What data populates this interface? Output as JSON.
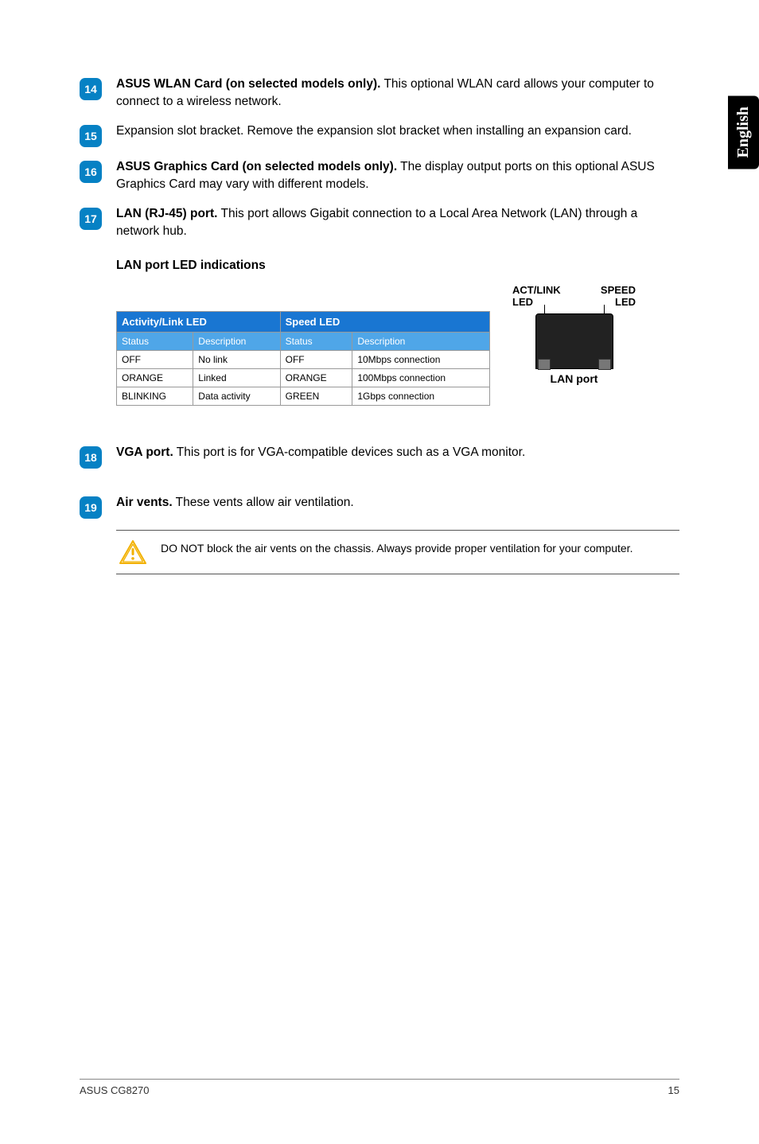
{
  "side_tab": "English",
  "items": {
    "i14": {
      "num": "14",
      "text_prefix": "ASUS WLAN Card (on selected models only).",
      "text_rest": " This optional WLAN card allows your computer to connect to a wireless network."
    },
    "i15": {
      "num": "15",
      "text_prefix": "",
      "text_rest": "Expansion slot bracket. Remove the expansion slot bracket when installing an expansion card."
    },
    "i16": {
      "num": "16",
      "text_prefix": "ASUS Graphics Card (on selected models only).",
      "text_rest": " The display output ports on this optional ASUS Graphics Card may vary with different models."
    },
    "i17": {
      "num": "17",
      "text_prefix": "LAN (RJ-45) port.",
      "text_rest": " This port allows Gigabit connection to a Local Area Network (LAN) through a network hub."
    },
    "led_title": "LAN port LED indications",
    "i18": {
      "num": "18",
      "text_prefix": "VGA port.",
      "text_rest": " This port is for VGA-compatible devices such as a VGA monitor."
    },
    "i19": {
      "num": "19",
      "text_prefix": "Air vents.",
      "text_rest": " These vents allow air ventilation."
    }
  },
  "table": {
    "group1": "Activity/Link LED",
    "group2": "Speed LED",
    "sub_status": "Status",
    "sub_desc": "Description",
    "rows": [
      {
        "a_status": "OFF",
        "a_desc": "No link",
        "s_status": "OFF",
        "s_desc": "10Mbps connection"
      },
      {
        "a_status": "ORANGE",
        "a_desc": "Linked",
        "s_status": "ORANGE",
        "s_desc": "100Mbps connection"
      },
      {
        "a_status": "BLINKING",
        "a_desc": "Data activity",
        "s_status": "GREEN",
        "s_desc": "1Gbps connection"
      }
    ]
  },
  "diagram": {
    "actlink": "ACT/LINK LED",
    "speed": "SPEED LED",
    "lan_port": "LAN port"
  },
  "caution": "DO NOT block the air vents on the chassis. Always provide proper ventilation for your computer.",
  "footer": {
    "left": "ASUS CG8270",
    "right": "15"
  }
}
